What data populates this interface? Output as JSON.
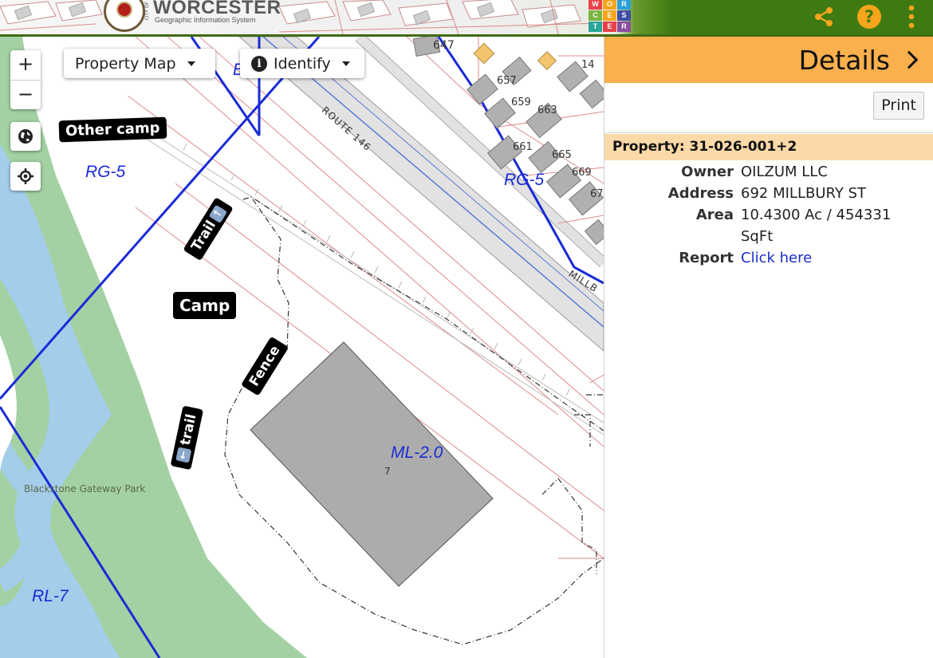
{
  "header": {
    "logo_title": "WORCESTER",
    "logo_subtitle": "Geographic Information System",
    "logo_city_word": "CITY OF",
    "tiles": [
      "W",
      "O",
      "R",
      "C",
      "E",
      "S",
      "T",
      "E",
      "R"
    ],
    "tile_colors": [
      "#e8414a",
      "#f7a51c",
      "#2a9fd8",
      "#7ab540",
      "#f7a51c",
      "#3f4fa6",
      "#2aa59a",
      "#e8414a",
      "#8c4d9e"
    ],
    "actions": [
      {
        "name": "share-icon"
      },
      {
        "name": "help-icon"
      },
      {
        "name": "more-vertical-icon"
      }
    ],
    "accent_color": "#3e7a11"
  },
  "map": {
    "controls": {
      "zoom_in": "+",
      "zoom_out": "−",
      "globe_icon": "globe-icon",
      "locate_icon": "crosshair-icon"
    },
    "basemap_dropdown": "Property Map",
    "identify_dropdown": "Identify",
    "zone_labels": [
      "RG-5",
      "RG-5",
      "ML-2.0",
      "RL-7",
      "B"
    ],
    "road_labels": [
      "ROUTE 146",
      "MILLB"
    ],
    "park_label": "Blackstone Gateway Park",
    "parcel_numbers": [
      "647",
      "14",
      "657",
      "659",
      "663",
      "661",
      "665",
      "669",
      "67",
      "7"
    ],
    "annotations": {
      "other_camp": "Other camp",
      "camp": "Camp",
      "trail_up": "Trail",
      "fence": "Fence",
      "trail_down": "trail"
    }
  },
  "panel": {
    "title": "Details",
    "print_button": "Print",
    "property_heading": "Property: 31-026-001+2",
    "attributes": [
      {
        "key": "Owner",
        "value": "OILZUM LLC"
      },
      {
        "key": "Address",
        "value": "692 MILLBURY ST"
      },
      {
        "key": "Area",
        "value": "10.4300 Ac / 454331 SqFt"
      },
      {
        "key": "Report",
        "value": "Click here"
      }
    ],
    "header_color": "#f9b04d",
    "property_bar_color": "#fcd9a8"
  }
}
